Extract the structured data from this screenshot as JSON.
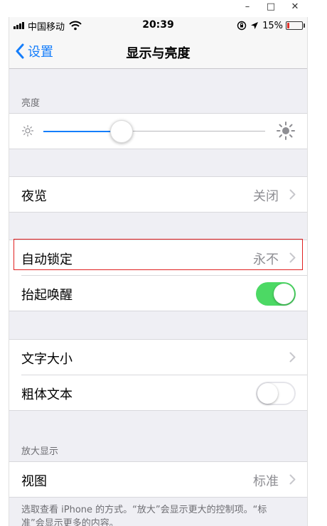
{
  "window": {
    "minimize": "–",
    "maximize": "□",
    "close": "✕"
  },
  "status_bar": {
    "carrier": "中国移动",
    "time": "20:39",
    "battery_percent": "15%",
    "battery_level": 0.15,
    "icons": [
      "signal-bars-icon",
      "wifi-icon",
      "rotation-lock-icon",
      "location-icon",
      "battery-icon"
    ]
  },
  "nav": {
    "back_label": "设置",
    "title": "显示与亮度"
  },
  "brightness": {
    "header": "亮度",
    "level": 0.35
  },
  "night_shift": {
    "label": "夜览",
    "value": "关闭"
  },
  "auto_lock": {
    "label": "自动锁定",
    "value": "永不"
  },
  "raise_to_wake": {
    "label": "抬起唤醒",
    "enabled": true
  },
  "text_size": {
    "label": "文字大小"
  },
  "bold_text": {
    "label": "粗体文本",
    "enabled": false
  },
  "zoom": {
    "header": "放大显示",
    "view_label": "视图",
    "view_value": "标准"
  },
  "footer": "选取查看 iPhone 的方式。“放大”会显示更大的控制项。“标准”会显示更多的内容。",
  "colors": {
    "accent": "#157efb",
    "toggle_on": "#4cd964",
    "toggle_off_border": "#e5e5ea",
    "highlight": "#e02020",
    "battery_low": "#e0312b"
  }
}
